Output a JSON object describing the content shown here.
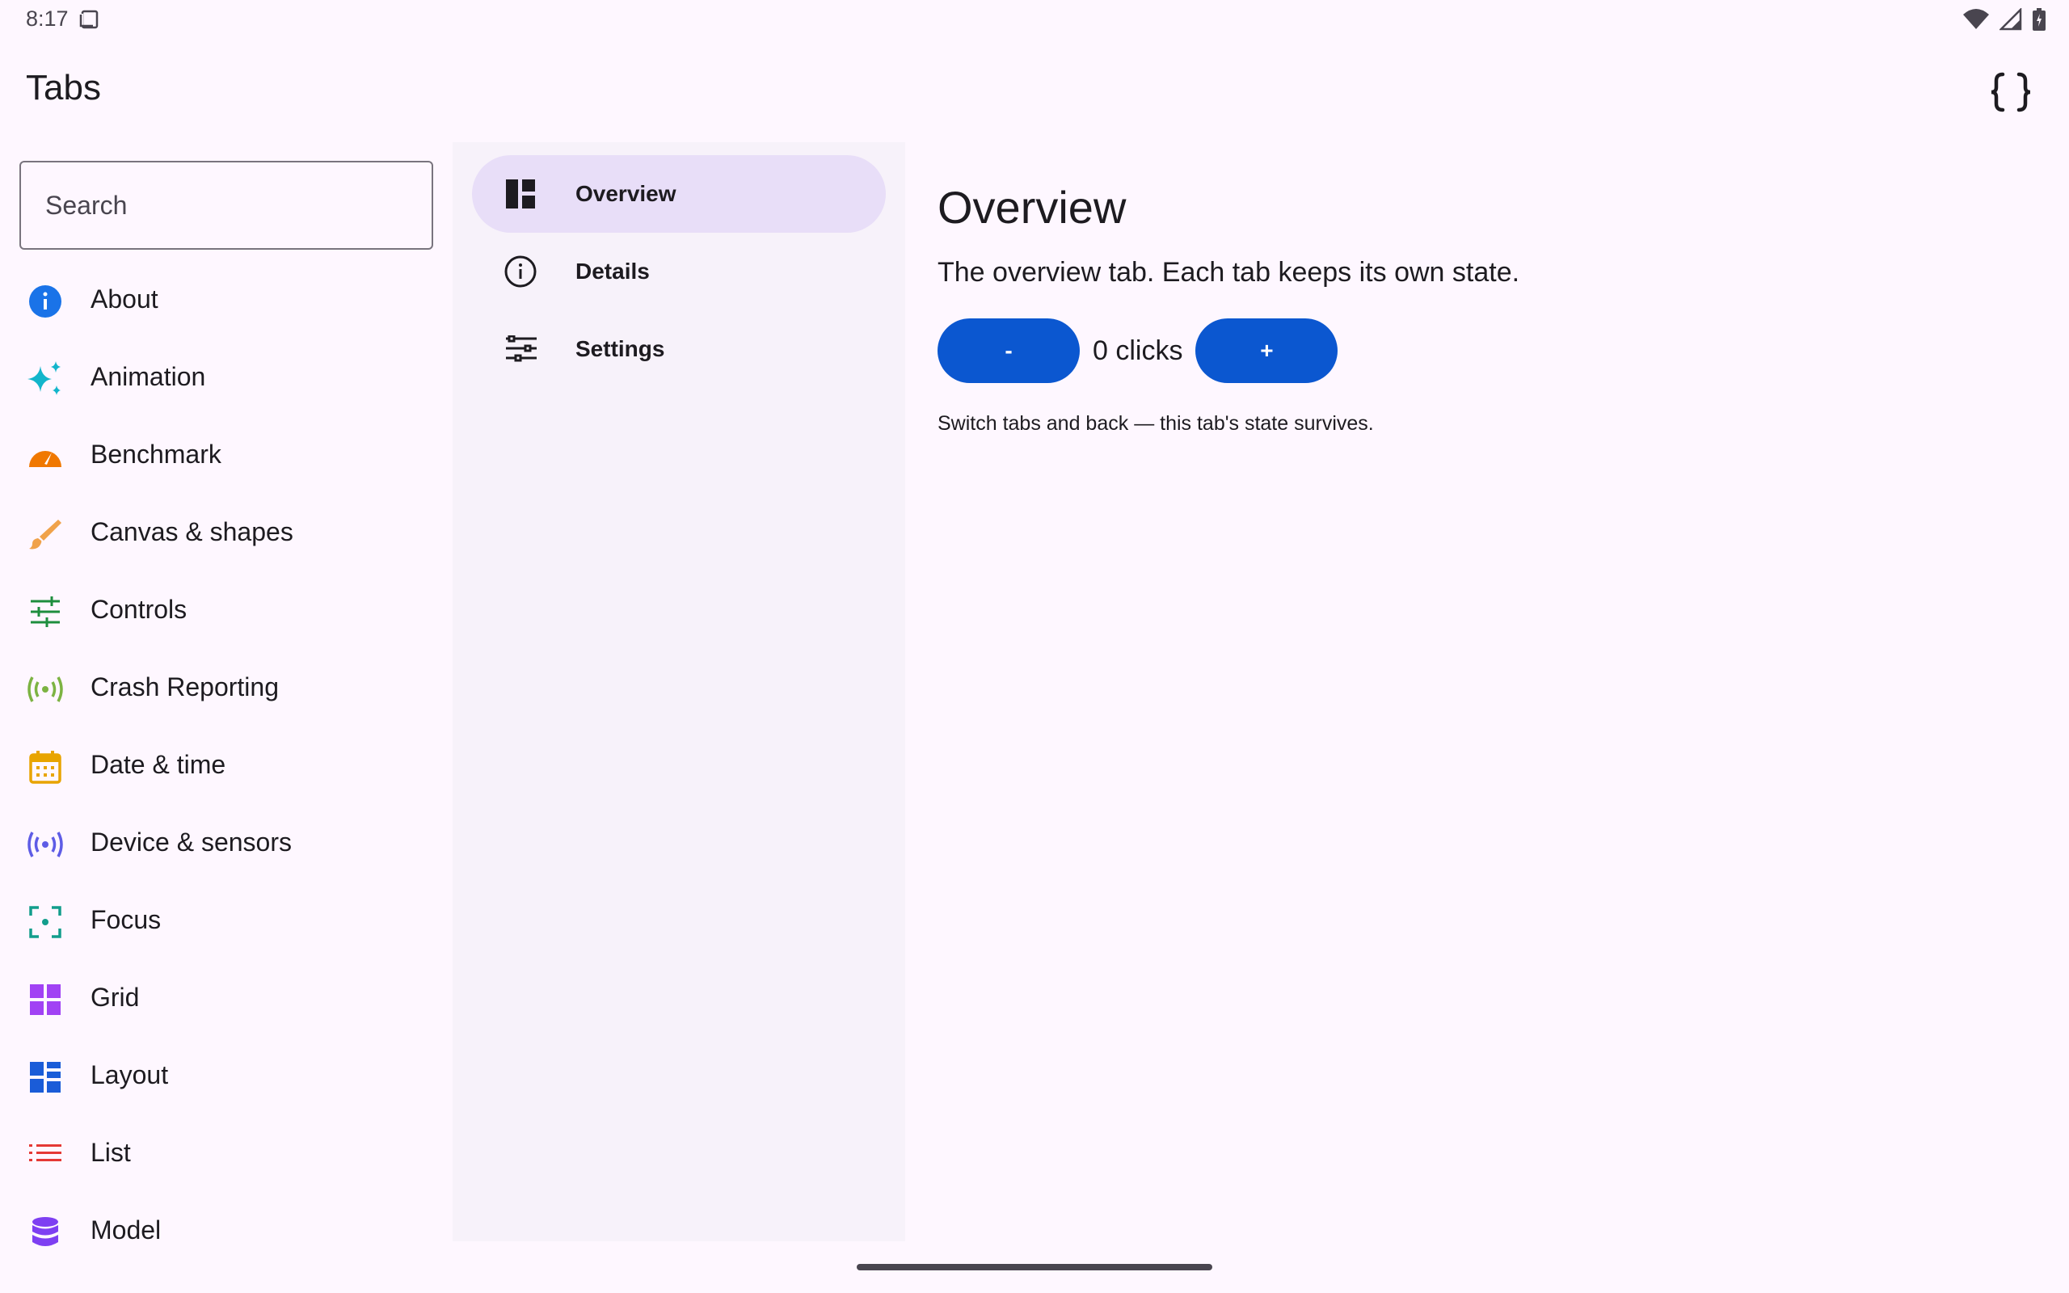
{
  "status_bar": {
    "time": "8:17",
    "icons": [
      "screen-icon",
      "wifi-icon",
      "signal-icon",
      "battery-icon"
    ]
  },
  "app_bar": {
    "title": "Tabs",
    "action_icon": "code-braces-icon"
  },
  "sidebar": {
    "search_placeholder": "Search",
    "items": [
      {
        "label": "About",
        "icon": "info-icon",
        "color": "#1a73e8"
      },
      {
        "label": "Animation",
        "icon": "sparkle-icon",
        "color": "#12b5cb"
      },
      {
        "label": "Benchmark",
        "icon": "speed-icon",
        "color": "#f07800"
      },
      {
        "label": "Canvas & shapes",
        "icon": "brush-icon",
        "color": "#f0a24a"
      },
      {
        "label": "Controls",
        "icon": "tune-icon",
        "color": "#1e8e3e"
      },
      {
        "label": "Crash Reporting",
        "icon": "broadcast-icon",
        "color": "#7cb342"
      },
      {
        "label": "Date & time",
        "icon": "calendar-icon",
        "color": "#e8a400"
      },
      {
        "label": "Device & sensors",
        "icon": "sensors-icon",
        "color": "#5e5ce6"
      },
      {
        "label": "Focus",
        "icon": "focus-icon",
        "color": "#129d8c"
      },
      {
        "label": "Grid",
        "icon": "grid-icon",
        "color": "#a142f4"
      },
      {
        "label": "Layout",
        "icon": "dashboard-icon",
        "color": "#1a5cd8"
      },
      {
        "label": "List",
        "icon": "list-icon",
        "color": "#e53935"
      },
      {
        "label": "Model",
        "icon": "database-icon",
        "color": "#7e3ff2"
      }
    ]
  },
  "tabs": {
    "selected": "Overview",
    "items": [
      {
        "label": "Overview",
        "icon": "dashboard-icon"
      },
      {
        "label": "Details",
        "icon": "info-outline-icon"
      },
      {
        "label": "Settings",
        "icon": "tune-icon"
      }
    ]
  },
  "content": {
    "title": "Overview",
    "description": "The overview tab. Each tab keeps its own state.",
    "decrement_label": "-",
    "count_text": "0 clicks",
    "increment_label": "+",
    "hint": "Switch tabs and back — this tab's state survives."
  },
  "colors": {
    "accent": "#0b57d0",
    "selected_tab_bg": "#e8def8",
    "rail_bg": "#f7f2fa",
    "background": "#fef7ff"
  }
}
